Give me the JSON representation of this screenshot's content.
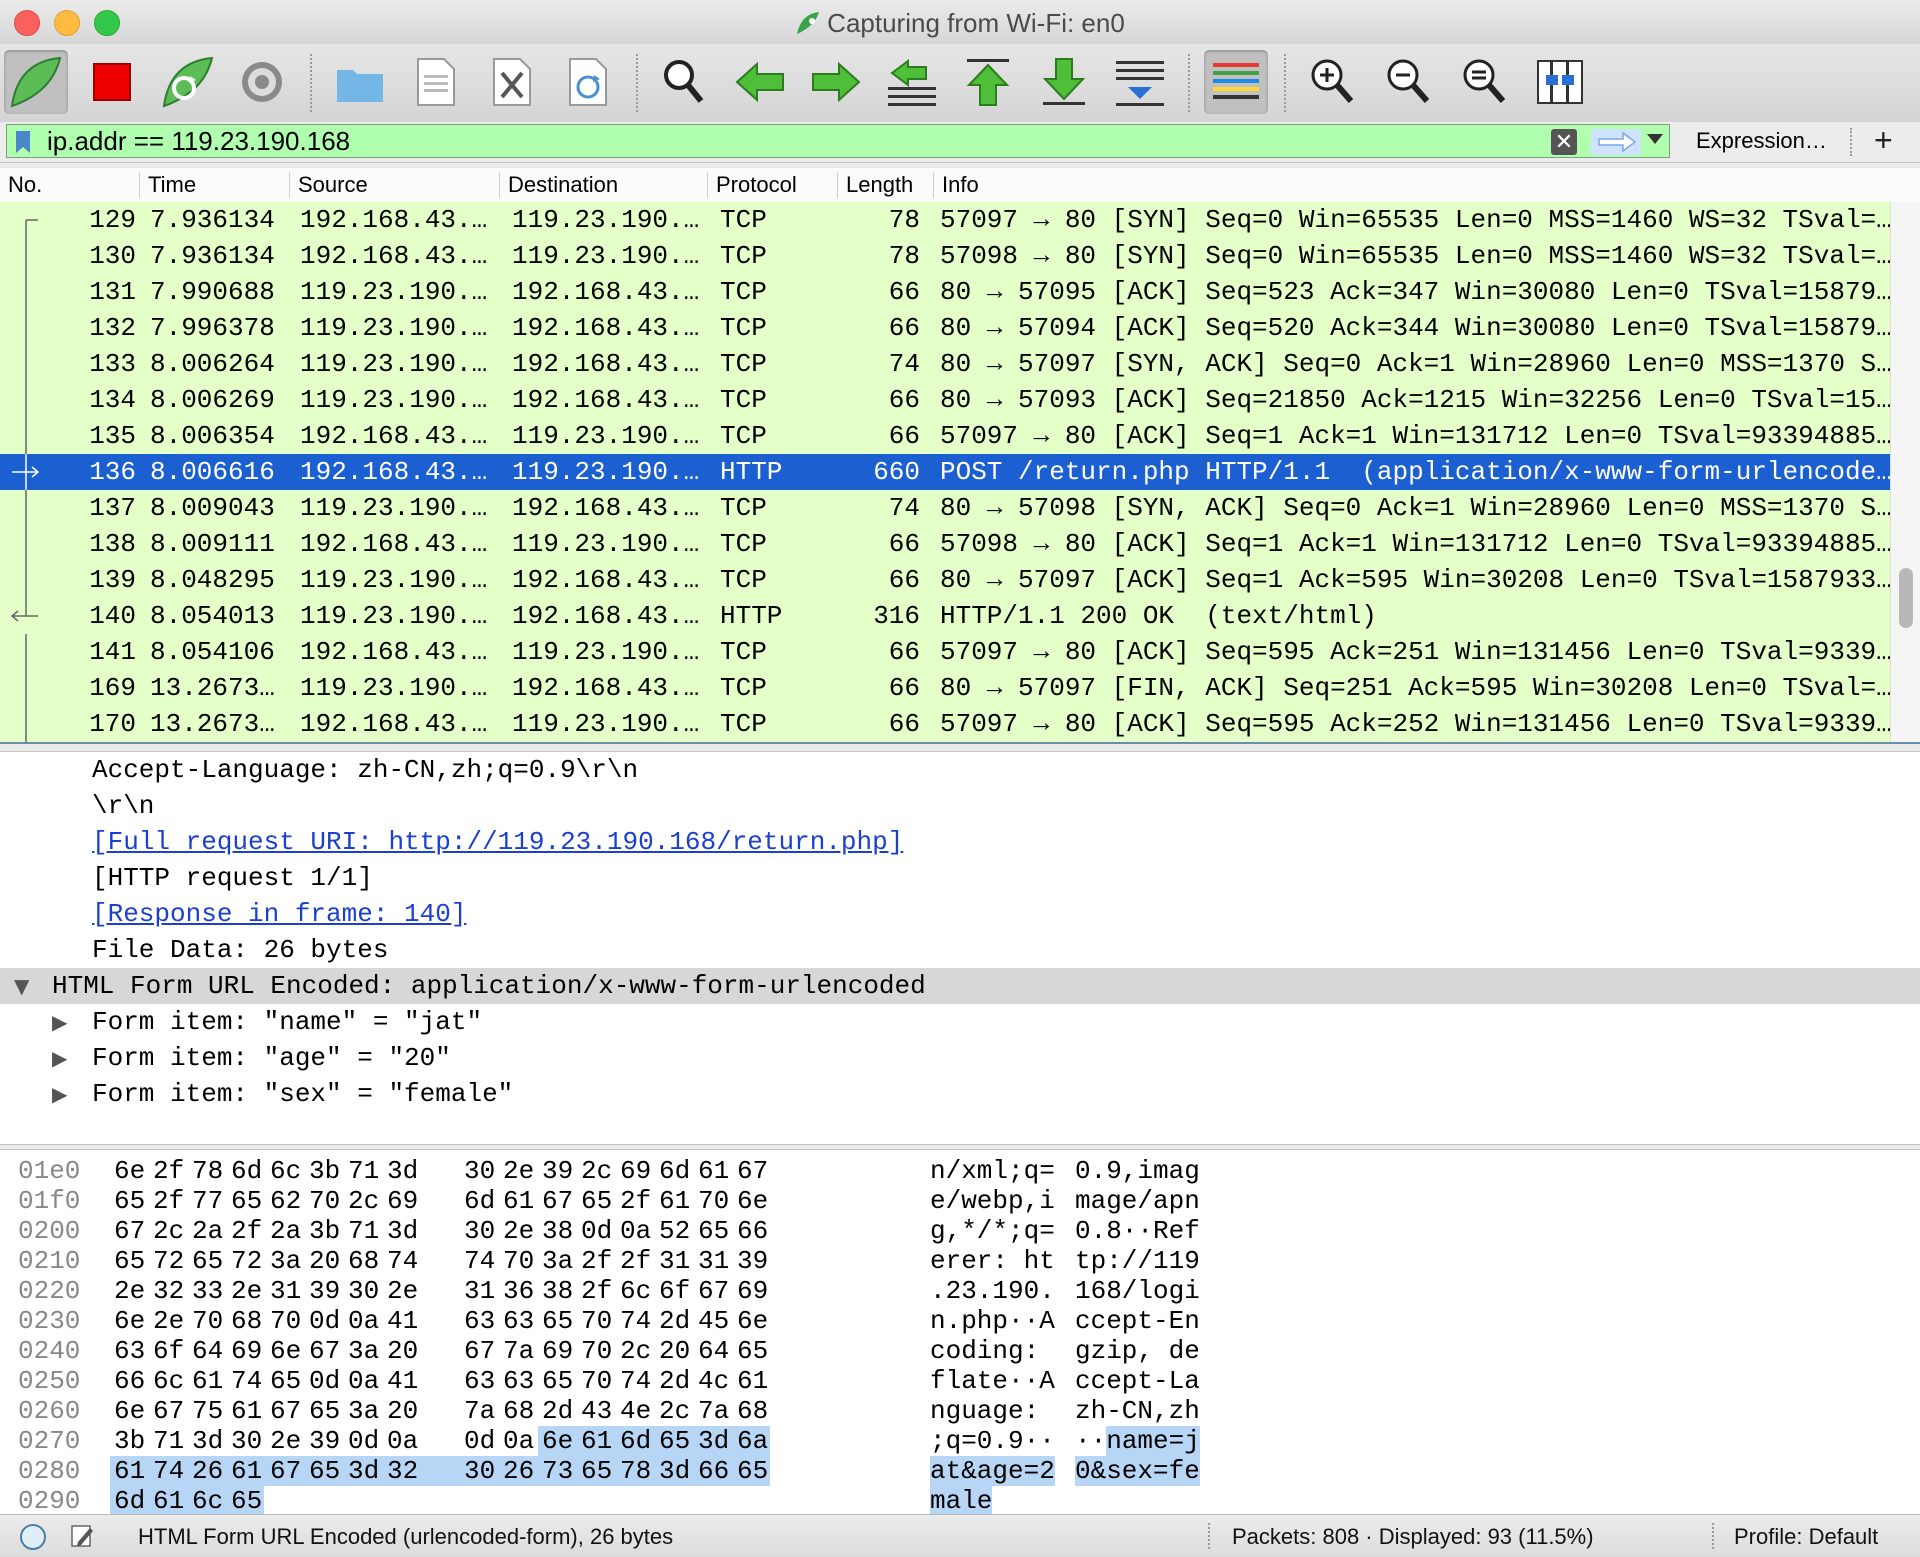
{
  "window": {
    "title": "Capturing from Wi-Fi: en0"
  },
  "filter": {
    "value": "ip.addr == 119.23.190.168",
    "expression_label": "Expression…",
    "add_label": "+"
  },
  "packet_list": {
    "columns": [
      "No.",
      "Time",
      "Source",
      "Destination",
      "Protocol",
      "Length",
      "Info"
    ],
    "rows": [
      {
        "no": "129",
        "time": "7.936134",
        "src": "192.168.43.…",
        "dst": "119.23.190.…",
        "proto": "TCP",
        "len": "78",
        "info": "57097 → 80 [SYN] Seq=0 Win=65535 Len=0 MSS=1460 WS=32 TSval=…",
        "marker": "start"
      },
      {
        "no": "130",
        "time": "7.936134",
        "src": "192.168.43.…",
        "dst": "119.23.190.…",
        "proto": "TCP",
        "len": "78",
        "info": "57098 → 80 [SYN] Seq=0 Win=65535 Len=0 MSS=1460 WS=32 TSval=…",
        "marker": "line"
      },
      {
        "no": "131",
        "time": "7.990688",
        "src": "119.23.190.…",
        "dst": "192.168.43.…",
        "proto": "TCP",
        "len": "66",
        "info": "80 → 57095 [ACK] Seq=523 Ack=347 Win=30080 Len=0 TSval=15879…",
        "marker": "line"
      },
      {
        "no": "132",
        "time": "7.996378",
        "src": "119.23.190.…",
        "dst": "192.168.43.…",
        "proto": "TCP",
        "len": "66",
        "info": "80 → 57094 [ACK] Seq=520 Ack=344 Win=30080 Len=0 TSval=15879…",
        "marker": "line"
      },
      {
        "no": "133",
        "time": "8.006264",
        "src": "119.23.190.…",
        "dst": "192.168.43.…",
        "proto": "TCP",
        "len": "74",
        "info": "80 → 57097 [SYN, ACK] Seq=0 Ack=1 Win=28960 Len=0 MSS=1370 S…",
        "marker": "line"
      },
      {
        "no": "134",
        "time": "8.006269",
        "src": "119.23.190.…",
        "dst": "192.168.43.…",
        "proto": "TCP",
        "len": "66",
        "info": "80 → 57093 [ACK] Seq=21850 Ack=1215 Win=32256 Len=0 TSval=15…",
        "marker": "line"
      },
      {
        "no": "135",
        "time": "8.006354",
        "src": "192.168.43.…",
        "dst": "119.23.190.…",
        "proto": "TCP",
        "len": "66",
        "info": "57097 → 80 [ACK] Seq=1 Ack=1 Win=131712 Len=0 TSval=93394885…",
        "marker": "line"
      },
      {
        "no": "136",
        "time": "8.006616",
        "src": "192.168.43.…",
        "dst": "119.23.190.…",
        "proto": "HTTP",
        "len": "660",
        "info": "POST /return.php HTTP/1.1  (application/x-www-form-urlencode…",
        "marker": "request",
        "selected": true
      },
      {
        "no": "137",
        "time": "8.009043",
        "src": "119.23.190.…",
        "dst": "192.168.43.…",
        "proto": "TCP",
        "len": "74",
        "info": "80 → 57098 [SYN, ACK] Seq=0 Ack=1 Win=28960 Len=0 MSS=1370 S…",
        "marker": "line"
      },
      {
        "no": "138",
        "time": "8.009111",
        "src": "192.168.43.…",
        "dst": "119.23.190.…",
        "proto": "TCP",
        "len": "66",
        "info": "57098 → 80 [ACK] Seq=1 Ack=1 Win=131712 Len=0 TSval=93394885…",
        "marker": "line"
      },
      {
        "no": "139",
        "time": "8.048295",
        "src": "119.23.190.…",
        "dst": "192.168.43.…",
        "proto": "TCP",
        "len": "66",
        "info": "80 → 57097 [ACK] Seq=1 Ack=595 Win=30208 Len=0 TSval=1587933…",
        "marker": "line"
      },
      {
        "no": "140",
        "time": "8.054013",
        "src": "119.23.190.…",
        "dst": "192.168.43.…",
        "proto": "HTTP",
        "len": "316",
        "info": "HTTP/1.1 200 OK  (text/html)",
        "marker": "response"
      },
      {
        "no": "141",
        "time": "8.054106",
        "src": "192.168.43.…",
        "dst": "119.23.190.…",
        "proto": "TCP",
        "len": "66",
        "info": "57097 → 80 [ACK] Seq=595 Ack=251 Win=131456 Len=0 TSval=9339…",
        "marker": "line"
      },
      {
        "no": "169",
        "time": "13.2673…",
        "src": "119.23.190.…",
        "dst": "192.168.43.…",
        "proto": "TCP",
        "len": "66",
        "info": "80 → 57097 [FIN, ACK] Seq=251 Ack=595 Win=30208 Len=0 TSval=…",
        "marker": "line"
      },
      {
        "no": "170",
        "time": "13.2673…",
        "src": "192.168.43.…",
        "dst": "119.23.190.…",
        "proto": "TCP",
        "len": "66",
        "info": "57097 → 80 [ACK] Seq=595 Ack=252 Win=131456 Len=0 TSval=9339…",
        "marker": "line"
      }
    ]
  },
  "details": {
    "lines": [
      {
        "text": "Accept-Language: zh-CN,zh;q=0.9\\r\\n",
        "kind": "plain"
      },
      {
        "text": "\\r\\n",
        "kind": "plain"
      },
      {
        "text": "[Full request URI: http://119.23.190.168/return.php]",
        "kind": "link"
      },
      {
        "text": "[HTTP request 1/1]",
        "kind": "plain"
      },
      {
        "text": "[Response in frame: 140]",
        "kind": "link"
      },
      {
        "text": "File Data: 26 bytes",
        "kind": "plain"
      }
    ],
    "section": {
      "text": "HTML Form URL Encoded: application/x-www-form-urlencoded",
      "expanded": true
    },
    "items": [
      {
        "text": "Form item: \"name\" = \"jat\""
      },
      {
        "text": "Form item: \"age\" = \"20\""
      },
      {
        "text": "Form item: \"sex\" = \"female\""
      }
    ]
  },
  "hex": {
    "rows": [
      {
        "offset": "01e0",
        "bytes": [
          "6e",
          "2f",
          "78",
          "6d",
          "6c",
          "3b",
          "71",
          "3d",
          "30",
          "2e",
          "39",
          "2c",
          "69",
          "6d",
          "61",
          "67"
        ],
        "ascii": [
          "n/xml;q=",
          "0.9,imag"
        ],
        "hl_from": 16
      },
      {
        "offset": "01f0",
        "bytes": [
          "65",
          "2f",
          "77",
          "65",
          "62",
          "70",
          "2c",
          "69",
          "6d",
          "61",
          "67",
          "65",
          "2f",
          "61",
          "70",
          "6e"
        ],
        "ascii": [
          "e/webp,i",
          "mage/apn"
        ],
        "hl_from": 16
      },
      {
        "offset": "0200",
        "bytes": [
          "67",
          "2c",
          "2a",
          "2f",
          "2a",
          "3b",
          "71",
          "3d",
          "30",
          "2e",
          "38",
          "0d",
          "0a",
          "52",
          "65",
          "66"
        ],
        "ascii": [
          "g,*/*;q=",
          "0.8··Ref"
        ],
        "hl_from": 16
      },
      {
        "offset": "0210",
        "bytes": [
          "65",
          "72",
          "65",
          "72",
          "3a",
          "20",
          "68",
          "74",
          "74",
          "70",
          "3a",
          "2f",
          "2f",
          "31",
          "31",
          "39"
        ],
        "ascii": [
          "erer: ht",
          "tp://119"
        ],
        "hl_from": 16
      },
      {
        "offset": "0220",
        "bytes": [
          "2e",
          "32",
          "33",
          "2e",
          "31",
          "39",
          "30",
          "2e",
          "31",
          "36",
          "38",
          "2f",
          "6c",
          "6f",
          "67",
          "69"
        ],
        "ascii": [
          ".23.190.",
          "168/logi"
        ],
        "hl_from": 16
      },
      {
        "offset": "0230",
        "bytes": [
          "6e",
          "2e",
          "70",
          "68",
          "70",
          "0d",
          "0a",
          "41",
          "63",
          "63",
          "65",
          "70",
          "74",
          "2d",
          "45",
          "6e"
        ],
        "ascii": [
          "n.php··A",
          "ccept-En"
        ],
        "hl_from": 16
      },
      {
        "offset": "0240",
        "bytes": [
          "63",
          "6f",
          "64",
          "69",
          "6e",
          "67",
          "3a",
          "20",
          "67",
          "7a",
          "69",
          "70",
          "2c",
          "20",
          "64",
          "65"
        ],
        "ascii": [
          "coding: ",
          "gzip, de"
        ],
        "hl_from": 16
      },
      {
        "offset": "0250",
        "bytes": [
          "66",
          "6c",
          "61",
          "74",
          "65",
          "0d",
          "0a",
          "41",
          "63",
          "63",
          "65",
          "70",
          "74",
          "2d",
          "4c",
          "61"
        ],
        "ascii": [
          "flate··A",
          "ccept-La"
        ],
        "hl_from": 16
      },
      {
        "offset": "0260",
        "bytes": [
          "6e",
          "67",
          "75",
          "61",
          "67",
          "65",
          "3a",
          "20",
          "7a",
          "68",
          "2d",
          "43",
          "4e",
          "2c",
          "7a",
          "68"
        ],
        "ascii": [
          "nguage: ",
          "zh-CN,zh"
        ],
        "hl_from": 16
      },
      {
        "offset": "0270",
        "bytes": [
          "3b",
          "71",
          "3d",
          "30",
          "2e",
          "39",
          "0d",
          "0a",
          "0d",
          "0a",
          "6e",
          "61",
          "6d",
          "65",
          "3d",
          "6a"
        ],
        "ascii": [
          ";q=0.9··",
          "··name=j"
        ],
        "hl_from": 10
      },
      {
        "offset": "0280",
        "bytes": [
          "61",
          "74",
          "26",
          "61",
          "67",
          "65",
          "3d",
          "32",
          "30",
          "26",
          "73",
          "65",
          "78",
          "3d",
          "66",
          "65"
        ],
        "ascii": [
          "at&age=2",
          "0&sex=fe"
        ],
        "hl_from": 0
      },
      {
        "offset": "0290",
        "bytes": [
          "6d",
          "61",
          "6c",
          "65"
        ],
        "ascii": [
          "male",
          ""
        ],
        "hl_from": 0
      }
    ]
  },
  "statusbar": {
    "message": "HTML Form URL Encoded (urlencoded-form), 26 bytes",
    "packets": "Packets: 808 · Displayed: 93 (11.5%)",
    "profile": "Profile: Default"
  },
  "colors": {
    "row_bg": "#e4ffc7",
    "selected_bg": "#1c5fd0",
    "filter_bg": "#afffaf",
    "hex_highlight": "#b7d6f5"
  }
}
